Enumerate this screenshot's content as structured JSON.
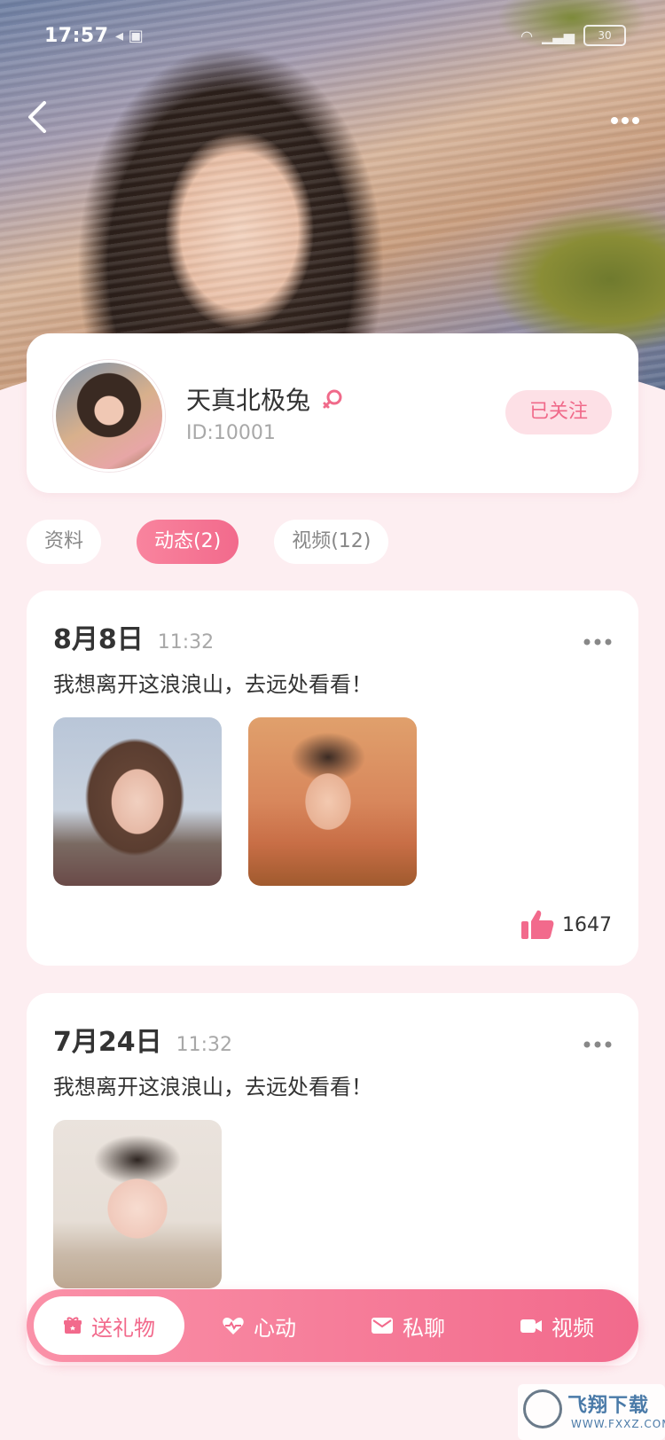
{
  "status_bar": {
    "time": "17:57",
    "battery": "30"
  },
  "profile": {
    "name": "天真北极兔",
    "id": "ID:10001",
    "follow_label": "已关注"
  },
  "tabs": [
    {
      "label": "资料"
    },
    {
      "label": "动态(2)"
    },
    {
      "label": "视频(12)"
    }
  ],
  "posts": [
    {
      "date": "8月8日",
      "time": "11:32",
      "text": "我想离开这浪浪山，去远处看看！",
      "likes": "1647"
    },
    {
      "date": "7月24日",
      "time": "11:32",
      "text": "我想离开这浪浪山，去远处看看！"
    }
  ],
  "actions": [
    {
      "label": "送礼物",
      "icon": "gift-icon"
    },
    {
      "label": "心动",
      "icon": "heartbeat-icon"
    },
    {
      "label": "私聊",
      "icon": "mail-icon"
    },
    {
      "label": "视频",
      "icon": "video-camera-icon"
    }
  ],
  "watermark": {
    "title": "飞翔下载",
    "url": "WWW.FXXZ.COM"
  },
  "colors": {
    "accent": "#f26a8c",
    "accent_light": "#fde0e6",
    "page_bg": "#fdeef1"
  }
}
